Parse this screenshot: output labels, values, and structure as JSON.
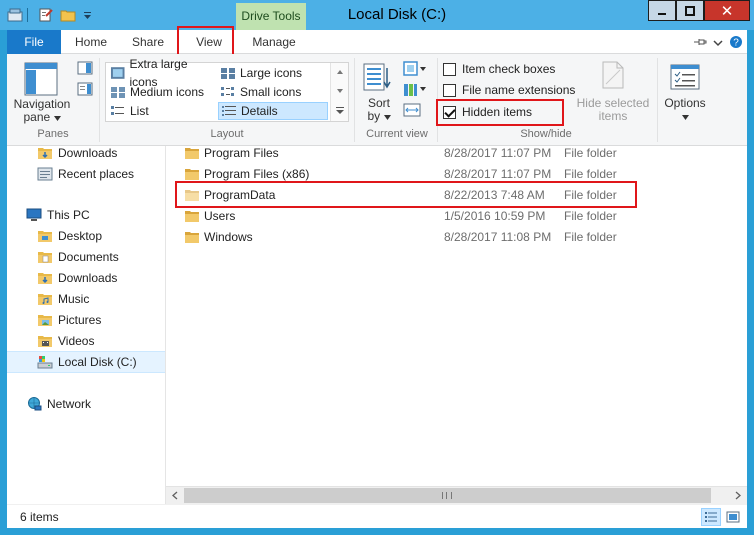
{
  "window": {
    "title": "Local Disk (C:)",
    "context_tab": "Drive Tools",
    "close_glyph": "✕"
  },
  "ribbon_tabs": [
    {
      "label": "File"
    },
    {
      "label": "Home"
    },
    {
      "label": "Share"
    },
    {
      "label": "View"
    },
    {
      "label": "Manage"
    }
  ],
  "ribbon": {
    "panes": {
      "navigation_pane_line1": "Navigation",
      "navigation_pane_line2": "pane",
      "group_label": "Panes"
    },
    "layout": {
      "items": [
        {
          "label": "Extra large icons"
        },
        {
          "label": "Large icons"
        },
        {
          "label": "Medium icons"
        },
        {
          "label": "Small icons"
        },
        {
          "label": "List"
        },
        {
          "label": "Details"
        }
      ],
      "group_label": "Layout"
    },
    "current_view": {
      "sort_line1": "Sort",
      "sort_line2": "by",
      "group_label": "Current view"
    },
    "show_hide": {
      "item_check_boxes": {
        "label": "Item check boxes",
        "checked": false
      },
      "file_name_extensions": {
        "label": "File name extensions",
        "checked": false
      },
      "hidden_items": {
        "label": "Hidden items",
        "checked": true
      },
      "hide_selected_line1": "Hide selected",
      "hide_selected_line2": "items",
      "group_label": "Show/hide"
    },
    "options_label": "Options"
  },
  "nav": {
    "items": [
      {
        "label": "Downloads"
      },
      {
        "label": "Recent places"
      },
      {
        "label": "This PC"
      },
      {
        "label": "Desktop"
      },
      {
        "label": "Documents"
      },
      {
        "label": "Downloads"
      },
      {
        "label": "Music"
      },
      {
        "label": "Pictures"
      },
      {
        "label": "Videos"
      },
      {
        "label": "Local Disk (C:)"
      },
      {
        "label": "Network"
      }
    ]
  },
  "files": [
    {
      "name": "Program Files",
      "date": "8/28/2017 11:07 PM",
      "type": "File folder"
    },
    {
      "name": "Program Files (x86)",
      "date": "8/28/2017 11:07 PM",
      "type": "File folder"
    },
    {
      "name": "ProgramData",
      "date": "8/22/2013 7:48 AM",
      "type": "File folder"
    },
    {
      "name": "Users",
      "date": "1/5/2016 10:59 PM",
      "type": "File folder"
    },
    {
      "name": "Windows",
      "date": "8/28/2017 11:08 PM",
      "type": "File folder"
    }
  ],
  "status": {
    "item_count": "6 items"
  },
  "colors": {
    "titlebar": "#4cb0e6",
    "file_tab": "#1979ca",
    "highlight": "#e0161a",
    "folder": "#e8b948",
    "drive_tools": "#bfe2b0"
  },
  "icons": {
    "folder": "folder-icon",
    "checkbox_checked": "check-icon",
    "this_pc": "computer-icon",
    "network": "network-icon",
    "local_disk": "drive-icon",
    "recent": "recent-places-icon"
  }
}
